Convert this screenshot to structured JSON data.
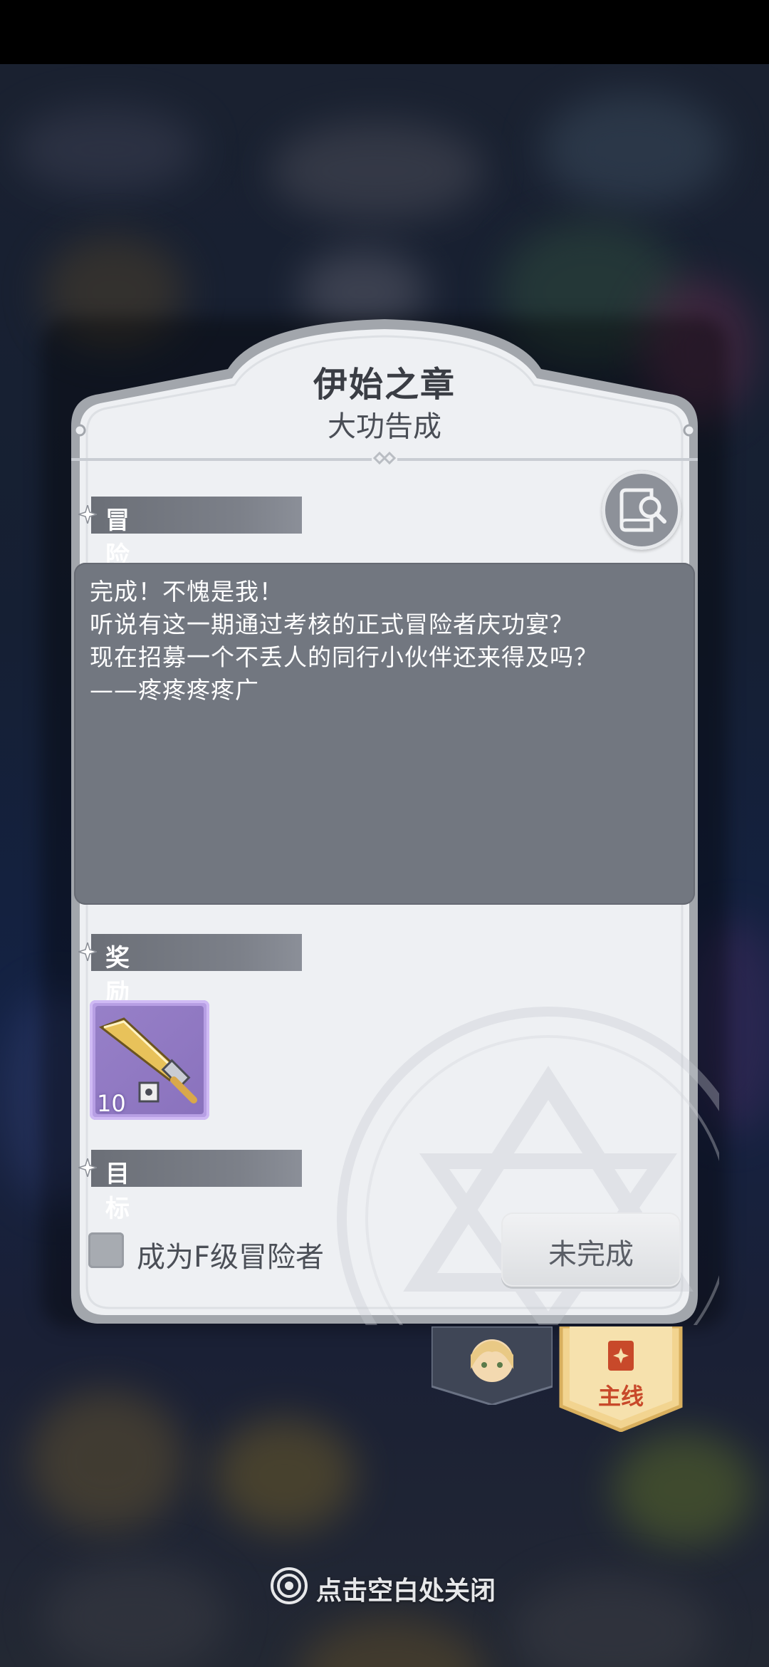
{
  "quest": {
    "title": "伊始之章",
    "subtitle": "大功告成"
  },
  "sections": {
    "log": "冒险日志",
    "reward": "奖励",
    "goal": "目标"
  },
  "log_lines": [
    "完成！不愧是我！",
    "听说有这一期通过考核的正式冒险者庆功宴？",
    "现在招募一个不丢人的同行小伙伴还来得及吗？",
    "——疼疼疼疼广"
  ],
  "reward": {
    "icon": "golden-sword-icon",
    "quantity": "10"
  },
  "goal": {
    "label": "成为F级冒险者",
    "checked": false,
    "status_button": "未完成"
  },
  "tabs": {
    "main_label": "主线"
  },
  "close_hint": "点击空白处关闭",
  "colors": {
    "panel": "#eef0f3",
    "panel_border": "#9ea2a8",
    "section_bar": "#757983",
    "log_box": "#727780",
    "reward_rarity": "#b79fe4",
    "main_tab_gold": "#f2d490"
  }
}
